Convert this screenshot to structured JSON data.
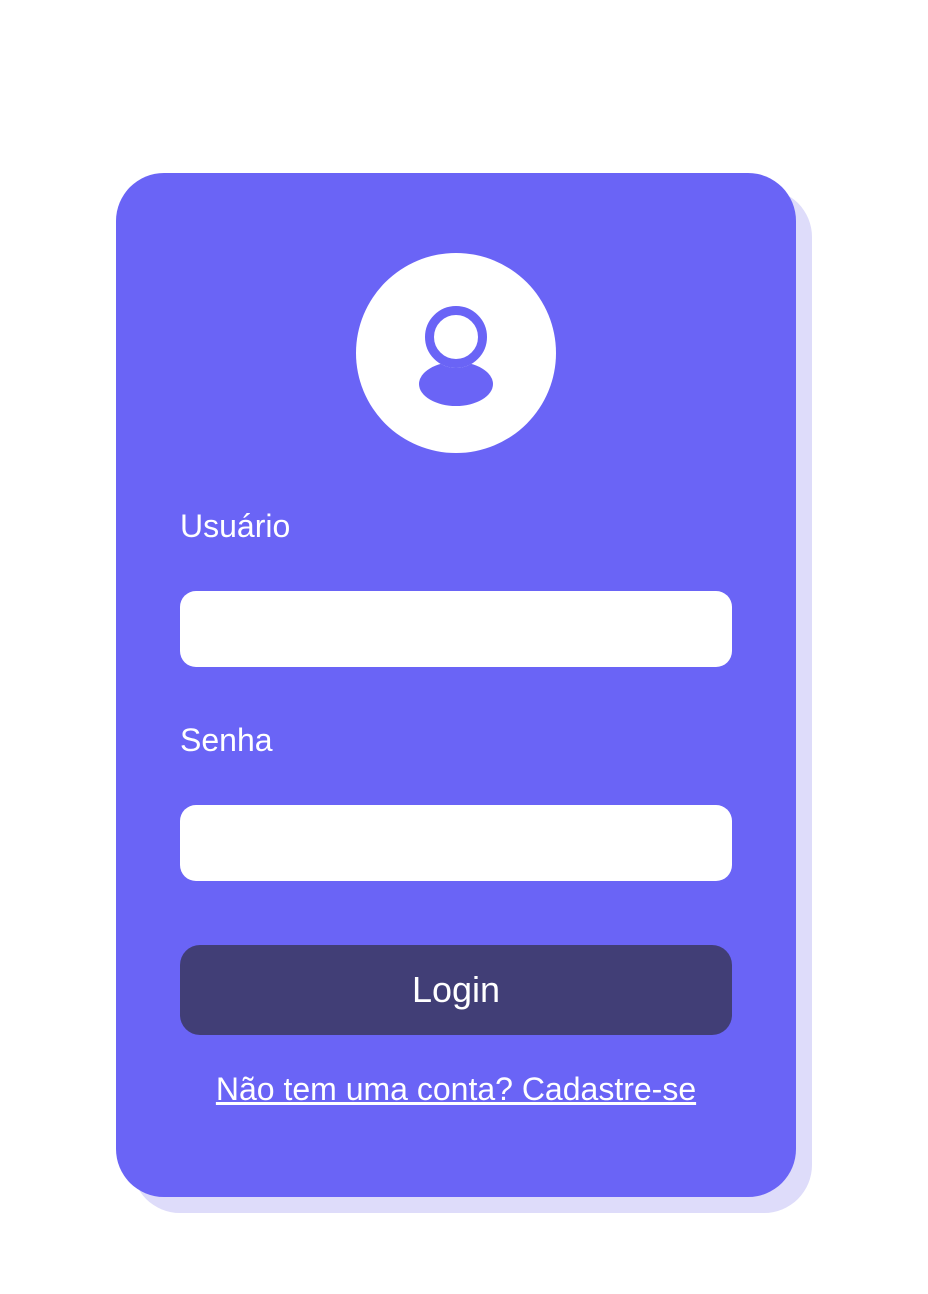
{
  "colors": {
    "card_background": "#6a64f6",
    "card_shadow": "#dedcfa",
    "button_background": "#413e76",
    "text": "#ffffff",
    "icon": "#6a64f6"
  },
  "avatar": {
    "icon": "user-icon"
  },
  "form": {
    "username_label": "Usuário",
    "username_value": "",
    "password_label": "Senha",
    "password_value": "",
    "login_label": "Login",
    "signup_link": "Não tem uma conta? Cadastre-se"
  }
}
